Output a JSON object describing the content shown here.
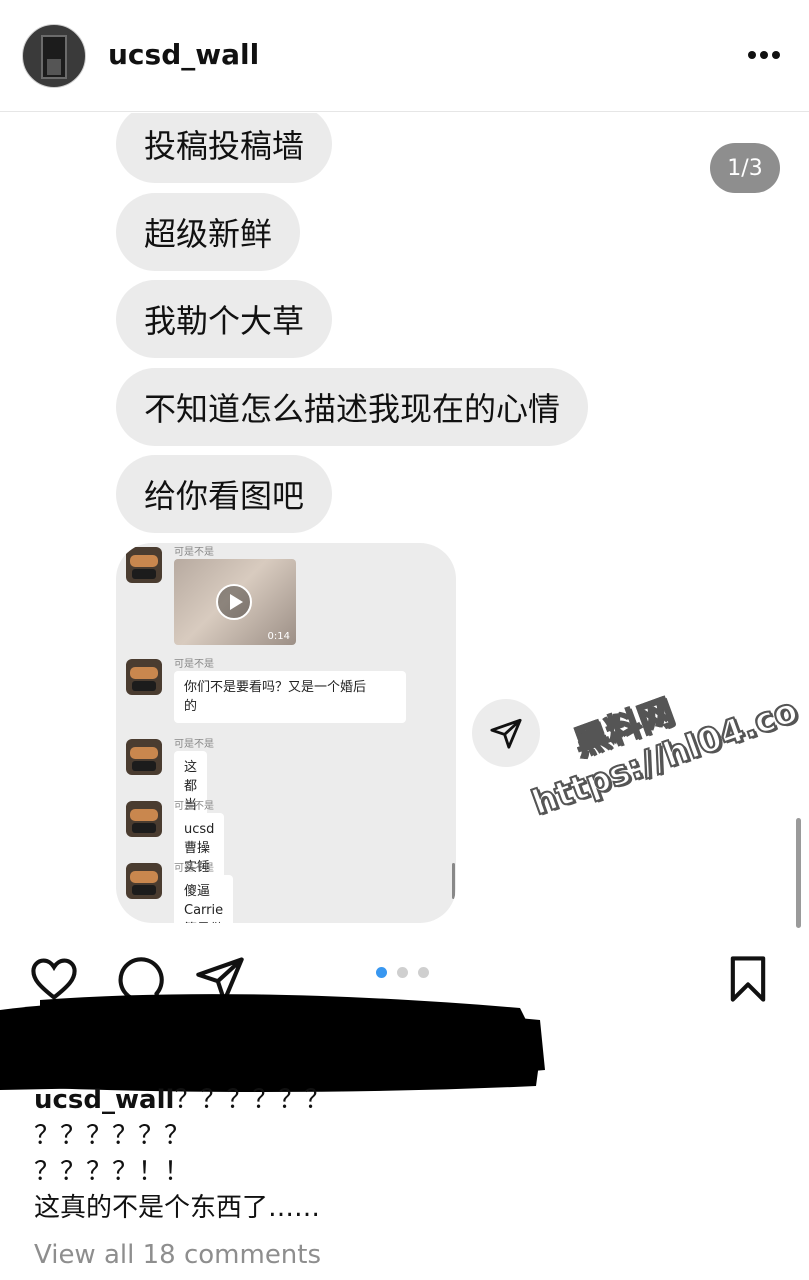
{
  "header": {
    "username": "ucsd_wall",
    "more_icon": "more-horizontal-icon"
  },
  "post": {
    "counter": "1/3",
    "bubbles": [
      "投稿投稿墙",
      "超级新鲜",
      "我勒个大草",
      "不知道怎么描述我现在的心情",
      "给你看图吧"
    ],
    "embedded_chat": {
      "video_sender": "可是不是",
      "video_duration": "0:14",
      "messages": [
        {
          "sender": "可是不是",
          "line1": "你们不是要看吗？又是一个婚后",
          "line2": "的"
        },
        {
          "sender": "可是不是",
          "line1": "这都当妈了"
        },
        {
          "sender": "可是不是",
          "line1": "ucsd曹操实锤"
        },
        {
          "sender": "可是不是",
          "line1": "傻逼Carrie算是做对了一件事"
        }
      ]
    }
  },
  "watermark": {
    "line1": "黑料网",
    "line2": "https://hl04.co"
  },
  "actions": {
    "like_icon": "heart-icon",
    "comment_icon": "comment-icon",
    "share_icon": "send-icon",
    "save_icon": "bookmark-icon",
    "carousel_active_index": 1,
    "carousel_total": 3,
    "accent_color": "#3897f0"
  },
  "caption": {
    "username": "ucsd_wall",
    "line1_rest": "？？？？？？",
    "line2": "？？？？？？",
    "line3": "？？？？！！",
    "line4": "这真的不是个东西了……"
  },
  "comments_link": "View all 18 comments"
}
